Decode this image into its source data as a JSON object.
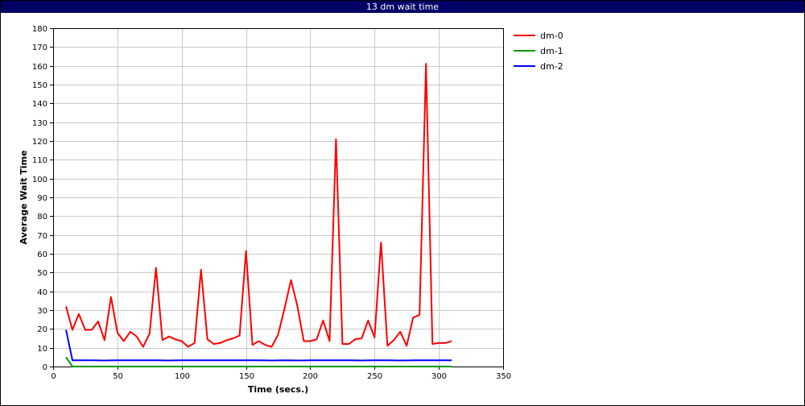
{
  "window": {
    "title": "13 dm wait time"
  },
  "chart_data": {
    "type": "line",
    "title": "13 dm wait time",
    "xlabel": "Time (secs.)",
    "ylabel": "Average Wait Time",
    "xlim": [
      0,
      350
    ],
    "ylim": [
      0,
      180
    ],
    "xticks": [
      0,
      50,
      100,
      150,
      200,
      250,
      300,
      350
    ],
    "yticks": [
      0,
      10,
      20,
      30,
      40,
      50,
      60,
      70,
      80,
      90,
      100,
      110,
      120,
      130,
      140,
      150,
      160,
      170,
      180
    ],
    "grid": true,
    "legend_position": "top-right outside",
    "series": [
      {
        "name": "dm-0",
        "color": "#ff0000",
        "points": [
          [
            10,
            32
          ],
          [
            15,
            19.5
          ],
          [
            20,
            28
          ],
          [
            25,
            19.5
          ],
          [
            30,
            19.5
          ],
          [
            35,
            24
          ],
          [
            40,
            14
          ],
          [
            45,
            37
          ],
          [
            50,
            18
          ],
          [
            55,
            13.5
          ],
          [
            60,
            18.5
          ],
          [
            65,
            16
          ],
          [
            70,
            10.5
          ],
          [
            75,
            17.5
          ],
          [
            80,
            52.5
          ],
          [
            85,
            14
          ],
          [
            90,
            16
          ],
          [
            95,
            14.5
          ],
          [
            100,
            13.5
          ],
          [
            105,
            10.5
          ],
          [
            110,
            12.5
          ],
          [
            115,
            51.5
          ],
          [
            120,
            14.5
          ],
          [
            125,
            12
          ],
          [
            130,
            12.5
          ],
          [
            135,
            14
          ],
          [
            140,
            15
          ],
          [
            145,
            16.5
          ],
          [
            150,
            61.5
          ],
          [
            155,
            11.5
          ],
          [
            160,
            13.5
          ],
          [
            165,
            11.5
          ],
          [
            170,
            10.5
          ],
          [
            175,
            17
          ],
          [
            180,
            31
          ],
          [
            185,
            46
          ],
          [
            190,
            32
          ],
          [
            195,
            13.5
          ],
          [
            200,
            13.5
          ],
          [
            205,
            14.5
          ],
          [
            210,
            24.5
          ],
          [
            215,
            13.5
          ],
          [
            220,
            121
          ],
          [
            225,
            12
          ],
          [
            230,
            12
          ],
          [
            235,
            14.5
          ],
          [
            240,
            15
          ],
          [
            245,
            24.5
          ],
          [
            250,
            15.5
          ],
          [
            255,
            66
          ],
          [
            260,
            11
          ],
          [
            265,
            14
          ],
          [
            270,
            18.5
          ],
          [
            275,
            11
          ],
          [
            280,
            26
          ],
          [
            285,
            27.5
          ],
          [
            290,
            161
          ],
          [
            295,
            12
          ],
          [
            300,
            12.5
          ],
          [
            305,
            12.5
          ],
          [
            310,
            13.5
          ]
        ]
      },
      {
        "name": "dm-1",
        "color": "#009900",
        "points": [
          [
            10,
            5
          ],
          [
            15,
            0
          ],
          [
            20,
            0
          ],
          [
            50,
            0
          ],
          [
            100,
            0
          ],
          [
            150,
            0
          ],
          [
            200,
            0
          ],
          [
            250,
            0
          ],
          [
            300,
            0
          ],
          [
            310,
            0
          ]
        ]
      },
      {
        "name": "dm-2",
        "color": "#0000ff",
        "points": [
          [
            10,
            19.5
          ],
          [
            15,
            3.3
          ],
          [
            20,
            3.3
          ],
          [
            30,
            3.3
          ],
          [
            40,
            3.2
          ],
          [
            50,
            3.3
          ],
          [
            60,
            3.3
          ],
          [
            70,
            3.3
          ],
          [
            80,
            3.3
          ],
          [
            90,
            3.2
          ],
          [
            100,
            3.3
          ],
          [
            110,
            3.3
          ],
          [
            120,
            3.3
          ],
          [
            130,
            3.3
          ],
          [
            140,
            3.3
          ],
          [
            150,
            3.3
          ],
          [
            160,
            3.3
          ],
          [
            170,
            3.2
          ],
          [
            180,
            3.3
          ],
          [
            190,
            3.2
          ],
          [
            200,
            3.3
          ],
          [
            210,
            3.3
          ],
          [
            220,
            3.3
          ],
          [
            230,
            3.3
          ],
          [
            240,
            3.2
          ],
          [
            250,
            3.3
          ],
          [
            260,
            3.3
          ],
          [
            270,
            3.2
          ],
          [
            280,
            3.3
          ],
          [
            290,
            3.3
          ],
          [
            300,
            3.3
          ],
          [
            310,
            3.3
          ]
        ]
      }
    ]
  }
}
